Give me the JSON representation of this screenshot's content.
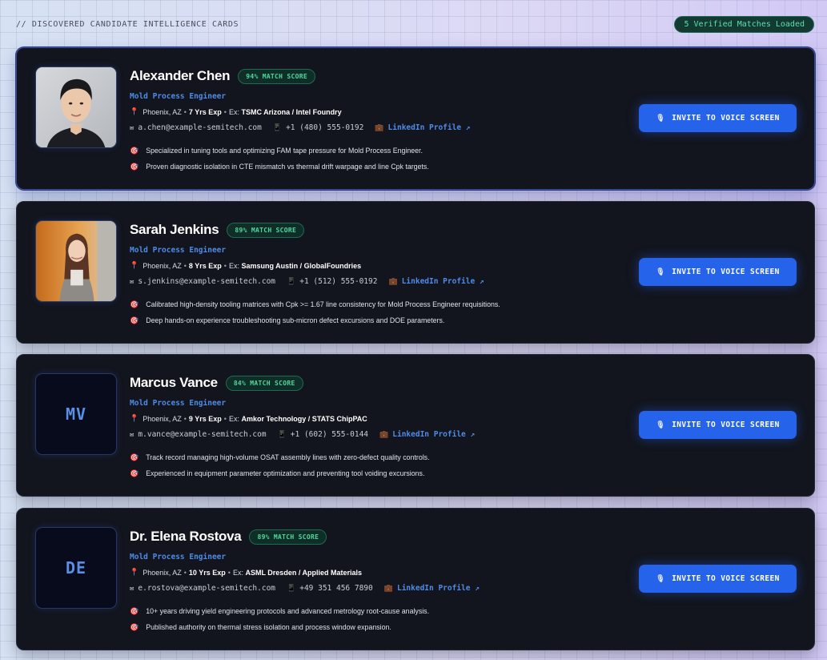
{
  "header": {
    "section_label": "// DISCOVERED CANDIDATE INTELLIGENCE CARDS",
    "verified_badge": "5 Verified Matches Loaded"
  },
  "icons": {
    "pin": "📍",
    "email": "✉",
    "phone": "📱",
    "briefcase": "💼",
    "dart": "🎯",
    "mic": "🎙",
    "external_arrow": "↗"
  },
  "colors": {
    "accent_blue": "#2563eb",
    "match_green": "#4fd89c",
    "card_bg": "#12151d"
  },
  "candidates": [
    {
      "name": "Alexander Chen",
      "score": "94% MATCH SCORE",
      "role": "Mold Process Engineer",
      "location": "Phoenix, AZ",
      "experience": "7 Yrs Exp",
      "ex_label": "Ex:",
      "companies": "TSMC Arizona / Intel Foundry",
      "email": "a.chen@example-semitech.com",
      "phone": "+1 (480) 555-0192",
      "linkedin": "LinkedIn Profile ↗",
      "bullets": [
        "Specialized in tuning tools and optimizing FAM tape pressure for Mold Process Engineer.",
        "Proven diagnostic isolation in CTE mismatch vs thermal drift warpage and line Cpk targets."
      ],
      "avatar": "photo",
      "invite_label": "INVITE TO VOICE SCREEN"
    },
    {
      "name": "Sarah Jenkins",
      "score": "89% MATCH SCORE",
      "role": "Mold Process Engineer",
      "location": "Phoenix, AZ",
      "experience": "8 Yrs Exp",
      "ex_label": "Ex:",
      "companies": "Samsung Austin / GlobalFoundries",
      "email": "s.jenkins@example-semitech.com",
      "phone": "+1 (512) 555-0192",
      "linkedin": "LinkedIn Profile ↗",
      "bullets": [
        "Calibrated high-density tooling matrices with Cpk >= 1.67 line consistency for Mold Process Engineer requisitions.",
        "Deep hands-on experience troubleshooting sub-micron defect excursions and DOE parameters."
      ],
      "avatar": "photo",
      "invite_label": "INVITE TO VOICE SCREEN"
    },
    {
      "name": "Marcus Vance",
      "score": "84% MATCH SCORE",
      "role": "Mold Process Engineer",
      "location": "Phoenix, AZ",
      "experience": "9 Yrs Exp",
      "ex_label": "Ex:",
      "companies": "Amkor Technology / STATS ChipPAC",
      "email": "m.vance@example-semitech.com",
      "phone": "+1 (602) 555-0144",
      "linkedin": "LinkedIn Profile ↗",
      "bullets": [
        "Track record managing high-volume OSAT assembly lines with zero-defect quality controls.",
        "Experienced in equipment parameter optimization and preventing tool voiding excursions."
      ],
      "initials": "MV",
      "invite_label": "INVITE TO VOICE SCREEN"
    },
    {
      "name": "Dr. Elena Rostova",
      "score": "89% MATCH SCORE",
      "role": "Mold Process Engineer",
      "location": "Phoenix, AZ",
      "experience": "10 Yrs Exp",
      "ex_label": "Ex:",
      "companies": "ASML Dresden / Applied Materials",
      "email": "e.rostova@example-semitech.com",
      "phone": "+49 351 456 7890",
      "linkedin": "LinkedIn Profile ↗",
      "bullets": [
        "10+ years driving yield engineering protocols and advanced metrology root-cause analysis.",
        "Published authority on thermal stress isolation and process window expansion."
      ],
      "initials": "DE",
      "invite_label": "INVITE TO VOICE SCREEN"
    }
  ]
}
